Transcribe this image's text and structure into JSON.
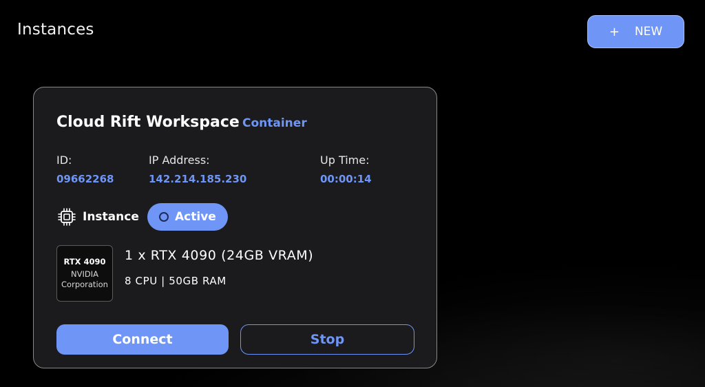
{
  "page": {
    "title": "Instances",
    "new_button": {
      "icon": "plus-icon",
      "icon_glyph": "+",
      "label": "NEW"
    }
  },
  "instance_card": {
    "name": "Cloud Rift Workspace",
    "type": "Container",
    "fields": {
      "id": {
        "label": "ID:",
        "value": "09662268"
      },
      "ip_address": {
        "label": "IP Address:",
        "value": "142.214.185.230"
      },
      "up_time": {
        "label": "Up Time:",
        "value": "00:00:14"
      }
    },
    "instance_label": "Instance",
    "instance_icon": "cpu-chip-icon",
    "status": {
      "icon": "ring-icon",
      "label": "Active"
    },
    "gpu_badge": {
      "model": "RTX 4090",
      "vendor_line1": "NVIDIA",
      "vendor_line2": "Corporation"
    },
    "gpu_spec": "1 x RTX 4090 (24GB VRAM)",
    "resources": "8 CPU | 50GB RAM",
    "connect_label": "Connect",
    "stop_label": "Stop"
  },
  "colors": {
    "accent": "#6f96f7",
    "background": "#000000",
    "card_background": "#1b1b1d",
    "card_border": "#8a8a8a"
  }
}
